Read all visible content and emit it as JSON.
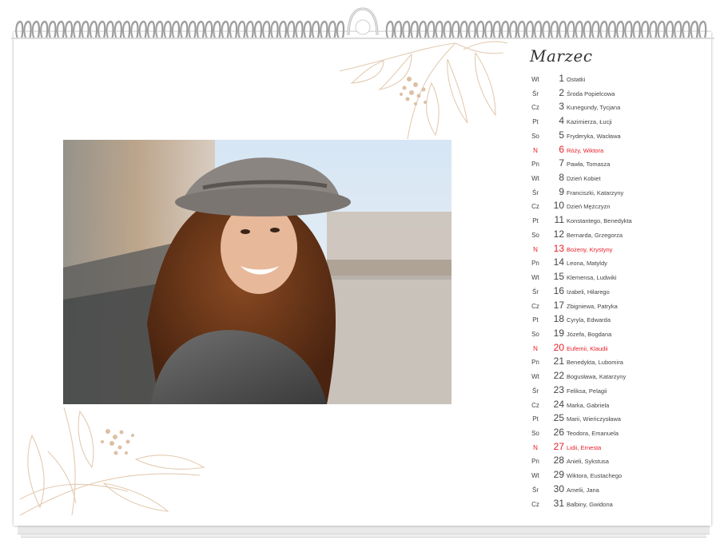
{
  "calendar": {
    "month": "Marzec",
    "days": [
      {
        "weekday": "Wt",
        "day": "1",
        "names": "Ostatki",
        "sunday": false
      },
      {
        "weekday": "Śr",
        "day": "2",
        "names": "Środa Popielcowa",
        "sunday": false
      },
      {
        "weekday": "Cz",
        "day": "3",
        "names": "Kunegundy, Tycjana",
        "sunday": false
      },
      {
        "weekday": "Pt",
        "day": "4",
        "names": "Kazimierza, Łucji",
        "sunday": false
      },
      {
        "weekday": "So",
        "day": "5",
        "names": "Fryderyka, Wacława",
        "sunday": false
      },
      {
        "weekday": "N",
        "day": "6",
        "names": "Róży, Wiktora",
        "sunday": true
      },
      {
        "weekday": "Pn",
        "day": "7",
        "names": "Pawła, Tomasza",
        "sunday": false
      },
      {
        "weekday": "Wt",
        "day": "8",
        "names": "Dzień Kobiet",
        "sunday": false
      },
      {
        "weekday": "Śr",
        "day": "9",
        "names": "Franciszki, Katarzyny",
        "sunday": false
      },
      {
        "weekday": "Cz",
        "day": "10",
        "names": "Dzień Mężczyzn",
        "sunday": false
      },
      {
        "weekday": "Pt",
        "day": "11",
        "names": "Konstantego, Benedykta",
        "sunday": false
      },
      {
        "weekday": "So",
        "day": "12",
        "names": "Bernarda, Grzegorza",
        "sunday": false
      },
      {
        "weekday": "N",
        "day": "13",
        "names": "Bożeny, Krystyny",
        "sunday": true
      },
      {
        "weekday": "Pn",
        "day": "14",
        "names": "Leona, Matyldy",
        "sunday": false
      },
      {
        "weekday": "Wt",
        "day": "15",
        "names": "Klemensa, Ludwiki",
        "sunday": false
      },
      {
        "weekday": "Śr",
        "day": "16",
        "names": "Izabeli, Hilarego",
        "sunday": false
      },
      {
        "weekday": "Cz",
        "day": "17",
        "names": "Zbigniewa, Patryka",
        "sunday": false
      },
      {
        "weekday": "Pt",
        "day": "18",
        "names": "Cyryla, Edwarda",
        "sunday": false
      },
      {
        "weekday": "So",
        "day": "19",
        "names": "Józefa, Bogdana",
        "sunday": false
      },
      {
        "weekday": "N",
        "day": "20",
        "names": "Eufemii, Klaudii",
        "sunday": true
      },
      {
        "weekday": "Pn",
        "day": "21",
        "names": "Benedykta, Lubomira",
        "sunday": false
      },
      {
        "weekday": "Wt",
        "day": "22",
        "names": "Bogusława, Katarzyny",
        "sunday": false
      },
      {
        "weekday": "Śr",
        "day": "23",
        "names": "Feliksa, Pelagii",
        "sunday": false
      },
      {
        "weekday": "Cz",
        "day": "24",
        "names": "Marka, Gabriela",
        "sunday": false
      },
      {
        "weekday": "Pt",
        "day": "25",
        "names": "Marii, Wieńczysława",
        "sunday": false
      },
      {
        "weekday": "So",
        "day": "26",
        "names": "Teodora, Emanuela",
        "sunday": false
      },
      {
        "weekday": "N",
        "day": "27",
        "names": "Lidii, Ernesta",
        "sunday": true
      },
      {
        "weekday": "Pn",
        "day": "28",
        "names": "Anieli, Sykstusa",
        "sunday": false
      },
      {
        "weekday": "Wt",
        "day": "29",
        "names": "Wiktora, Eustachego",
        "sunday": false
      },
      {
        "weekday": "Śr",
        "day": "30",
        "names": "Amelii, Jana",
        "sunday": false
      },
      {
        "weekday": "Cz",
        "day": "31",
        "names": "Balbiny, Gwidona",
        "sunday": false
      }
    ]
  },
  "colors": {
    "text": "#444444",
    "sunday": "#e8202a",
    "leaf_line": "#e3cbb1",
    "leaf_dot": "#dcc0a3"
  },
  "photo": {
    "subject": "smiling-woman-in-grey-hat"
  }
}
